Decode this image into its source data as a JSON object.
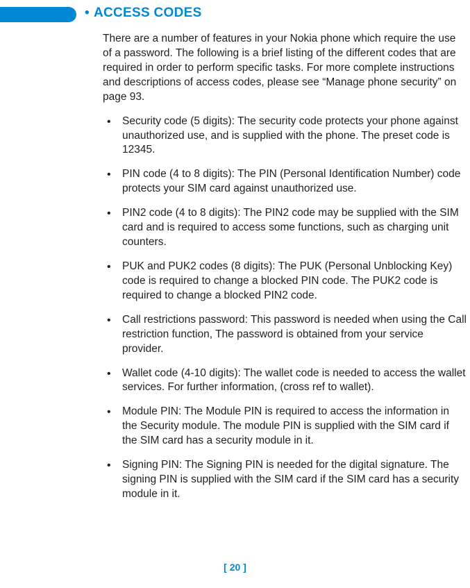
{
  "heading": {
    "bullet": "•",
    "text": "ACCESS CODES"
  },
  "intro": "There are a number of features in your Nokia phone which require the use of a password. The following is a brief listing of the different codes that are required in order to perform specific tasks. For more complete instructions and descriptions of access codes, please see “Manage phone security” on page 93.",
  "items": [
    "Security code (5 digits): The security code protects your phone against unauthorized use, and is supplied with the phone. The preset code is 12345.",
    "PIN code (4 to 8 digits): The PIN (Personal Identification Number) code protects your SIM card against unauthorized use.",
    "PIN2 code (4 to 8 digits): The PIN2 code may be supplied with the SIM card and is required to access some functions, such as charging unit counters.",
    "PUK and PUK2 codes (8 digits): The PUK (Personal Unblocking Key) code is required to change a blocked PIN code. The PUK2 code is required to change a blocked PIN2 code.",
    "Call restrictions password: This password is needed when using the Call restriction function, The password is obtained from your service provider.",
    "Wallet code (4-10 digits): The wallet code is needed to access the wallet services. For further information, (cross ref to wallet).",
    "Module PIN: The Module PIN is required to access the information in the Security module. The module PIN is supplied with the SIM card if the SIM card has a security module in it.",
    "Signing PIN: The Signing PIN is needed for the digital signature. The signing PIN is supplied with the SIM card if the SIM card has a security module in it."
  ],
  "page_number": "[ 20 ]"
}
